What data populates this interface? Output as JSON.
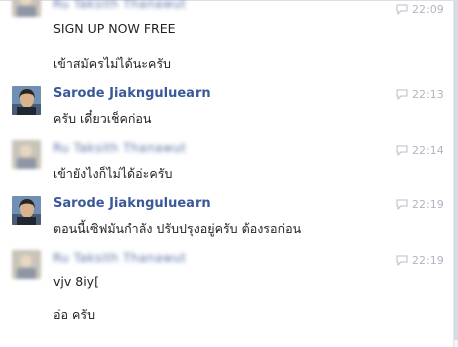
{
  "messages": [
    {
      "sender": "Ru Taksith Thanawut",
      "time": "22:09",
      "lines": [
        "SIGN UP NOW FREE",
        "เข้าสมัครไม่ได้นะครับ"
      ]
    },
    {
      "sender": "Sarode Jiaknguluearn",
      "time": "22:13",
      "lines": [
        "ครับ เดี๋ยวเช็คก่อน"
      ]
    },
    {
      "sender": "Ru Taksith Thanawut",
      "time": "22:14",
      "lines": [
        "เข้ายังไงก็ไม่ได้อ่ะครับ"
      ]
    },
    {
      "sender": "Sarode Jiaknguluearn",
      "time": "22:19",
      "lines": [
        "ตอนนี้เซิฟมันกำลัง ปรับปรุงอยู่ครับ ต้องรอก่อน"
      ]
    },
    {
      "sender": "Ru Taksith Thanawut",
      "time": "22:19",
      "lines": [
        "vjv 8iy[",
        "อ่อ ครับ"
      ]
    }
  ],
  "icons": {
    "timestamp": "speech-bubble-icon",
    "avatar_clear": "user-photo",
    "avatar_blurred": "blurred-user-photo"
  },
  "colors": {
    "sender_name": "#3b5998",
    "message_text": "#222222",
    "timestamp": "#b0b5c0"
  }
}
